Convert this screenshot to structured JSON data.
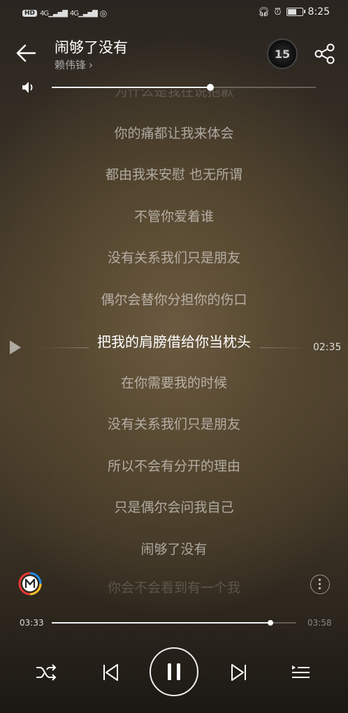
{
  "status_bar": {
    "hd_label": "HD",
    "net1": "4G",
    "net2": "4G",
    "time": "8:25"
  },
  "header": {
    "back_icon": "arrow-left-icon",
    "title": "闹够了没有",
    "artist": "赖伟锋",
    "avatar_text": "15",
    "share_icon": "share-icon"
  },
  "volume": {
    "level": 0.6,
    "icon": "speaker-icon"
  },
  "lyrics": {
    "lines": [
      {
        "text": "为什么是我在说抱歉",
        "state": "faded"
      },
      {
        "text": "你的痛都让我来体会",
        "state": "normal"
      },
      {
        "text": "都由我来安慰 也无所谓",
        "state": "normal"
      },
      {
        "text": "不管你爱着谁",
        "state": "normal"
      },
      {
        "text": "没有关系我们只是朋友",
        "state": "normal"
      },
      {
        "text": "偶尔会替你分担你的伤口",
        "state": "normal"
      },
      {
        "text": "把我的肩膀借给你当枕头",
        "state": "current"
      },
      {
        "text": "在你需要我的时候",
        "state": "normal"
      },
      {
        "text": "没有关系我们只是朋友",
        "state": "normal"
      },
      {
        "text": "所以不会有分开的理由",
        "state": "normal"
      },
      {
        "text": "只是偶尔会问我自己",
        "state": "normal"
      },
      {
        "text": "闹够了没有",
        "state": "normal"
      },
      {
        "text": "你会不会看到有一个我",
        "state": "faded"
      }
    ],
    "current_time": "02:35"
  },
  "progress": {
    "elapsed": "03:33",
    "duration": "03:58",
    "fraction": 0.895
  },
  "controls": {
    "shuffle_icon": "shuffle-icon",
    "prev_icon": "previous-icon",
    "pause_icon": "pause-icon",
    "next_icon": "next-icon",
    "playlist_icon": "playlist-icon"
  },
  "colors": {
    "accent": "#ffffff",
    "logo_red": "#e53935",
    "logo_blue": "#1e88e5",
    "logo_yellow": "#fbc02d"
  }
}
